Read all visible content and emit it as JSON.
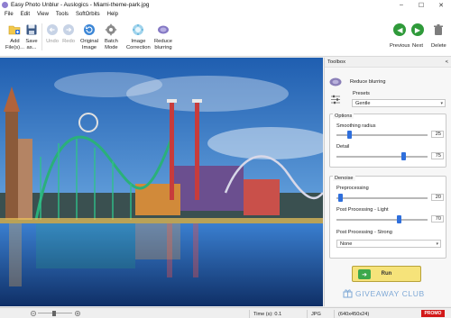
{
  "window": {
    "title": "Easy Photo Unblur - Auslogics - Miami-theme-park.jpg",
    "minimize": "–",
    "maximize": "☐",
    "close": "✕"
  },
  "menu": [
    "File",
    "Edit",
    "View",
    "Tools",
    "SoftOrbits",
    "Help"
  ],
  "toolbar": {
    "add_files": "Add\nFile(s)...",
    "save_as": "Save\nas...",
    "undo": "Undo",
    "redo": "Redo",
    "original_image": "Original\nImage",
    "batch_mode": "Batch\nMode",
    "image_correction": "Image\nCorrection",
    "reduce_blurring": "Reduce\nblurring",
    "previous": "Previous",
    "next": "Next",
    "delete": "Delete"
  },
  "toolbox": {
    "title": "Toolbox",
    "collapse": "<",
    "reduce_blurring_label": "Reduce blurring",
    "presets_label": "Presets",
    "preset_value": "Gentle",
    "options": {
      "title": "Options",
      "smoothing_radius_label": "Smoothing radius",
      "smoothing_radius_value": "25",
      "smoothing_radius_level": 0.12,
      "detail_label": "Detail",
      "detail_value": "75",
      "detail_level": 0.75
    },
    "denoise": {
      "title": "Denoise",
      "preprocessing_label": "Preprocessing",
      "preprocessing_value": "20",
      "preprocessing_level": 0.02,
      "post_light_label": "Post Processing - Light",
      "post_light_value": "70",
      "post_light_level": 0.7,
      "post_strong_label": "Post Processing - Strong",
      "post_strong_value": "None"
    },
    "run_label": "Run",
    "watermark": "GIVEAWAY CLUB"
  },
  "status": {
    "time": "Time (s): 0.1",
    "format": "JPG",
    "dimensions": "(640x450x24)",
    "promo": "PROMO"
  },
  "colors": {
    "accent": "#2f6fdc",
    "nav_green": "#2f9a3a",
    "run_yellow": "#f6e37a",
    "promo_red": "#d31818"
  }
}
